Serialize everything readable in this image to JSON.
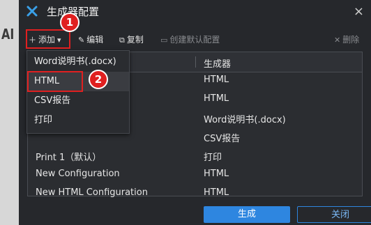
{
  "background": {
    "text": "AI"
  },
  "window": {
    "title": "生成器配置",
    "close_icon": "×"
  },
  "toolbar": {
    "add_label": "添加",
    "edit_label": "编辑",
    "copy_label": "复制",
    "default_label": "创建默认配置",
    "delete_label": "删除"
  },
  "table": {
    "columns": [
      "",
      "生成器"
    ],
    "rows": [
      {
        "name": "",
        "generator": "HTML"
      },
      {
        "name": "",
        "generator": "HTML"
      },
      {
        "name": "",
        "generator": "Word说明书(.docx)"
      },
      {
        "name": "",
        "generator": "CSV报告"
      },
      {
        "name": "Print 1（默认）",
        "generator": "打印"
      },
      {
        "name": "New Configuration",
        "generator": "HTML"
      },
      {
        "name": "New HTML Configuration",
        "generator": "HTML"
      }
    ]
  },
  "menu": {
    "items": [
      "Word说明书(.docx)",
      "HTML",
      "CSV报告",
      "打印"
    ]
  },
  "annotations": {
    "badge1": "1",
    "badge2": "2"
  },
  "buttons": {
    "generate": "生成",
    "close": "关闭"
  },
  "colors": {
    "accent": "#2e86e0",
    "annotation": "#e02020"
  }
}
